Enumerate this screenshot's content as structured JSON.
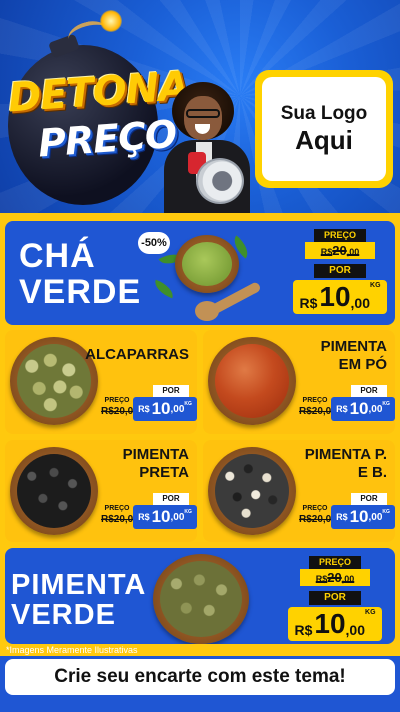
{
  "header": {
    "title_line1": "DETONA",
    "title_line2": "PREÇO",
    "logo_line1": "Sua Logo",
    "logo_line2": "Aqui"
  },
  "products": [
    {
      "name_line1": "CHÁ",
      "name_line2": "VERDE",
      "discount": "-50%",
      "price_label": "PREÇO",
      "old_price_int": "20",
      "old_price_dec": ",00",
      "old_price_prefix": "R$",
      "por_label": "POR",
      "currency": "R$",
      "new_price_int": "10",
      "new_price_dec": ",00",
      "unit": "KG"
    },
    {
      "name_line1": "ALCAPARRAS",
      "name_line2": "",
      "price_label": "PREÇO",
      "old_price": "R$20,00",
      "por_label": "POR",
      "currency": "R$",
      "new_price_int": "10",
      "new_price_dec": ",00",
      "unit": "KG"
    },
    {
      "name_line1": "PIMENTA",
      "name_line2": "EM PÓ",
      "price_label": "PREÇO",
      "old_price": "R$20,00",
      "por_label": "POR",
      "currency": "R$",
      "new_price_int": "10",
      "new_price_dec": ",00",
      "unit": "KG"
    },
    {
      "name_line1": "PIMENTA",
      "name_line2": "PRETA",
      "price_label": "PREÇO",
      "old_price": "R$20,00",
      "por_label": "POR",
      "currency": "R$",
      "new_price_int": "10",
      "new_price_dec": ",00",
      "unit": "KG"
    },
    {
      "name_line1": "PIMENTA P.",
      "name_line2": "E B.",
      "price_label": "PREÇO",
      "old_price": "R$20,00",
      "por_label": "POR",
      "currency": "R$",
      "new_price_int": "10",
      "new_price_dec": ",00",
      "unit": "KG"
    },
    {
      "name_line1": "PIMENTA",
      "name_line2": "VERDE",
      "price_label": "PREÇO",
      "old_price_int": "20",
      "old_price_dec": ",00",
      "old_price_prefix": "R$",
      "por_label": "POR",
      "currency": "R$",
      "new_price_int": "10",
      "new_price_dec": ",00",
      "unit": "KG"
    }
  ],
  "footer": {
    "disclaimer": "*Imagens Meramente Ilustrativas",
    "cta": "Crie seu encarte com este tema!"
  },
  "colors": {
    "brand_blue": "#1f56d3",
    "brand_yellow": "#ffc90e",
    "dark": "#111111"
  }
}
